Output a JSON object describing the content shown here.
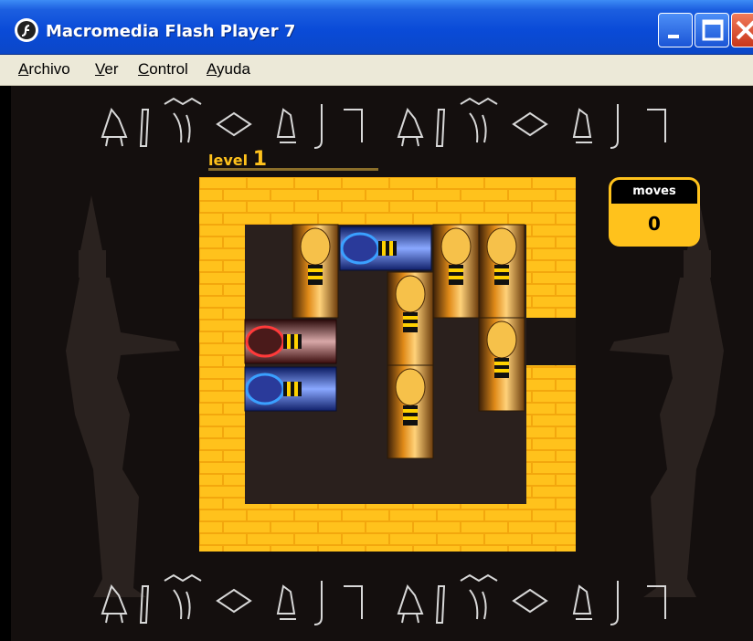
{
  "window": {
    "title": "Macromedia Flash Player 7"
  },
  "menu": [
    "Archivo",
    "Ver",
    "Control",
    "Ayuda"
  ],
  "game": {
    "level_label": "level",
    "level_value": "1",
    "moves_label": "moves",
    "moves_value": "0"
  },
  "colors": {
    "titlebar": "#0a4bd8",
    "brick": "#ffc21c",
    "floor": "#2a201d",
    "background": "#140f0e"
  },
  "icons": [
    "flash-player-icon",
    "minimize-icon",
    "maximize-icon",
    "close-icon",
    "hieroglyph-icon",
    "pharaoh-figure"
  ],
  "pieces": [
    {
      "type": "vertical",
      "color": "gold"
    },
    {
      "type": "horizontal",
      "color": "blue"
    },
    {
      "type": "vertical",
      "color": "gold"
    },
    {
      "type": "vertical",
      "color": "gold"
    },
    {
      "type": "vertical",
      "color": "gold"
    },
    {
      "type": "horizontal",
      "color": "red"
    },
    {
      "type": "vertical",
      "color": "gold"
    },
    {
      "type": "horizontal",
      "color": "blue"
    },
    {
      "type": "vertical",
      "color": "gold"
    }
  ]
}
